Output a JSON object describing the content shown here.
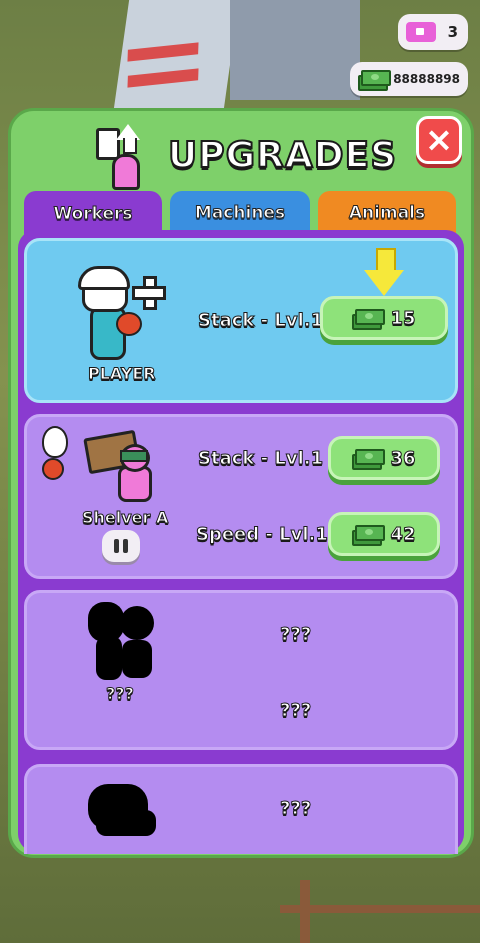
{
  "hud": {
    "tickets": "3",
    "cash": "88888898"
  },
  "panel": {
    "title": "UPGRADES",
    "close_icon": "×"
  },
  "tabs": [
    {
      "label": "Workers",
      "color": "#8a3bd0",
      "active": true
    },
    {
      "label": "Machines",
      "color": "#3a8fe0",
      "active": false
    },
    {
      "label": "Animals",
      "color": "#f08a22",
      "active": false
    }
  ],
  "workers": [
    {
      "name": "PLAYER",
      "stats": [
        {
          "label": "Stack - Lvl.1",
          "cost": "15"
        }
      ]
    },
    {
      "name": "Shelver A",
      "stats": [
        {
          "label": "Stack - Lvl.1",
          "cost": "36"
        },
        {
          "label": "Speed - Lvl.1",
          "cost": "42"
        }
      ]
    },
    {
      "name": "???",
      "stats": [
        {
          "label": "???"
        },
        {
          "label": "???"
        }
      ]
    },
    {
      "stats": [
        {
          "label": "???"
        }
      ]
    }
  ],
  "icons": {
    "ticket": "ticket-icon",
    "cash": "cash-icon",
    "upgrade": "upgrade-icon",
    "close": "close-icon",
    "hint_arrow": "down-arrow-icon",
    "pause": "pause-icon"
  },
  "colors": {
    "panel_green": "#7ed06a",
    "player_card": "#6fcaf0",
    "worker_card": "#b48cf0",
    "buy_button": "#8ee27a",
    "close_button": "#f04b4b"
  }
}
